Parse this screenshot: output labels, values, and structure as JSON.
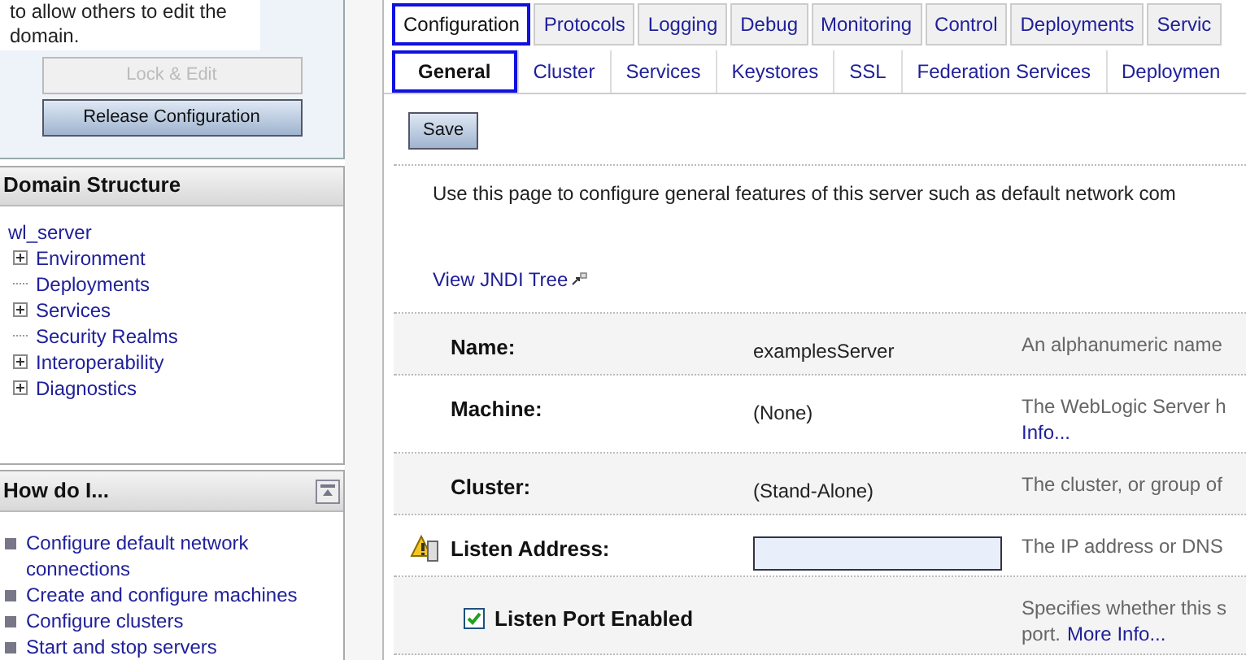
{
  "change_center": {
    "message": "to allow others to edit the domain.",
    "buttons": [
      {
        "label": "Lock & Edit",
        "disabled": true
      },
      {
        "label": "Release Configuration",
        "disabled": false
      }
    ]
  },
  "domain_structure": {
    "title": "Domain Structure",
    "root": "wl_server",
    "items": [
      {
        "label": "Environment",
        "expandable": true
      },
      {
        "label": "Deployments",
        "expandable": false
      },
      {
        "label": "Services",
        "expandable": true
      },
      {
        "label": "Security Realms",
        "expandable": false
      },
      {
        "label": "Interoperability",
        "expandable": true
      },
      {
        "label": "Diagnostics",
        "expandable": true
      }
    ]
  },
  "how_do_i": {
    "title": "How do I...",
    "links": [
      "Configure default network connections",
      "Create and configure machines",
      "Configure clusters",
      "Start and stop servers"
    ]
  },
  "tabs": [
    {
      "label": "Configuration",
      "selected": true
    },
    {
      "label": "Protocols",
      "selected": false
    },
    {
      "label": "Logging",
      "selected": false
    },
    {
      "label": "Debug",
      "selected": false
    },
    {
      "label": "Monitoring",
      "selected": false
    },
    {
      "label": "Control",
      "selected": false
    },
    {
      "label": "Deployments",
      "selected": false
    },
    {
      "label": "Servic",
      "selected": false
    }
  ],
  "subtabs": [
    {
      "label": "General",
      "selected": true
    },
    {
      "label": "Cluster",
      "selected": false
    },
    {
      "label": "Services",
      "selected": false
    },
    {
      "label": "Keystores",
      "selected": false
    },
    {
      "label": "SSL",
      "selected": false
    },
    {
      "label": "Federation Services",
      "selected": false
    },
    {
      "label": "Deploymen",
      "selected": false
    }
  ],
  "save_button": "Save",
  "intro": "Use this page to configure general features of this server such as default network com",
  "jndi_link": "View JNDI Tree",
  "fields": [
    {
      "kind": "text",
      "label": "Name:",
      "value": "examplesServer",
      "description": "An alphanumeric name"
    },
    {
      "kind": "text",
      "label": "Machine:",
      "value": "(None)",
      "description": "The WebLogic Server h",
      "more": "Info..."
    },
    {
      "kind": "text",
      "label": "Cluster:",
      "value": "(Stand-Alone)",
      "description": "The cluster, or group of"
    },
    {
      "kind": "input",
      "label": "Listen Address:",
      "warning": true,
      "description": "The IP address or DNS"
    },
    {
      "kind": "checkbox",
      "label": "Listen Port Enabled",
      "checked": true,
      "description": "Specifies whether this s",
      "description_2": "port.",
      "more": "More Info..."
    }
  ]
}
